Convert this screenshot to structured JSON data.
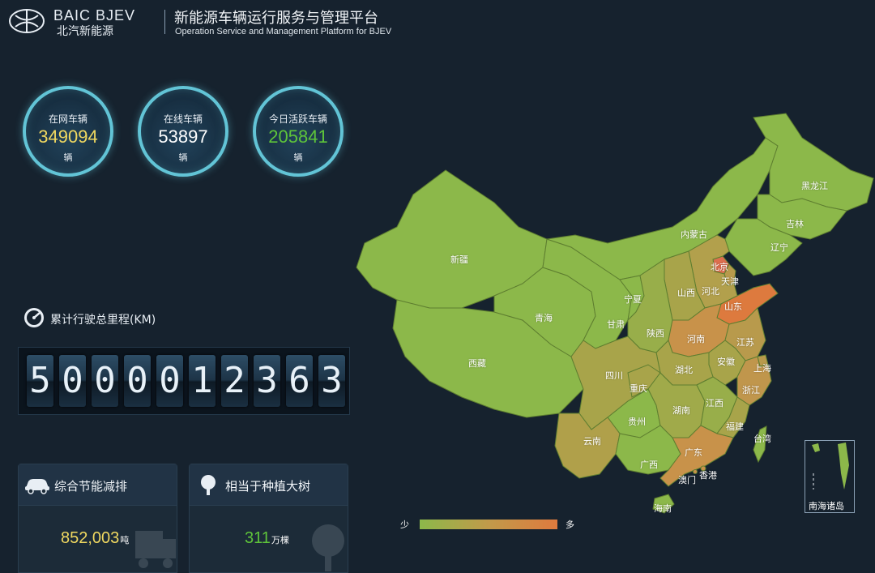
{
  "header": {
    "brand_en": "BAIC BJEV",
    "brand_cn": "北汽新能源",
    "platform_cn": "新能源车辆运行服务与管理平台",
    "platform_en": "Operation Service and Management Platform for BJEV"
  },
  "stats": [
    {
      "label": "在网车辆",
      "value": "349094",
      "unit": "辆",
      "color": "#f0d860"
    },
    {
      "label": "在线车辆",
      "value": "53897",
      "unit": "辆",
      "color": "#ffffff"
    },
    {
      "label": "今日活跃车辆",
      "value": "205841",
      "unit": "辆",
      "color": "#5ec43a"
    }
  ],
  "odometer": {
    "title": "累计行驶总里程(KM)",
    "digits": [
      "5",
      "0",
      "0",
      "0",
      "0",
      "1",
      "2",
      "3",
      "6",
      "3"
    ]
  },
  "cards": [
    {
      "title": "综合节能减排",
      "value": "852,003",
      "unit": "吨",
      "color": "#f0d860",
      "icon": "car-icon"
    },
    {
      "title": "相当于种植大树",
      "value": "311",
      "unit": "万棵",
      "color": "#5ec43a",
      "icon": "tree-icon"
    }
  ],
  "map": {
    "provinces": [
      "新疆",
      "西藏",
      "青海",
      "甘肃",
      "内蒙古",
      "黑龙江",
      "吉林",
      "辽宁",
      "北京",
      "天津",
      "河北",
      "山西",
      "宁夏",
      "陕西",
      "山东",
      "河南",
      "江苏",
      "安徽",
      "上海",
      "湖北",
      "四川",
      "重庆",
      "浙江",
      "江西",
      "湖南",
      "贵州",
      "云南",
      "福建",
      "台湾",
      "广西",
      "广东",
      "香港",
      "澳门",
      "海南"
    ],
    "inset_label": "南海诸岛",
    "colors": {
      "low": "#8cb84a",
      "mid": "#c19a4a",
      "high": "#de7a3e"
    }
  },
  "legend": {
    "low": "少",
    "high": "多"
  }
}
